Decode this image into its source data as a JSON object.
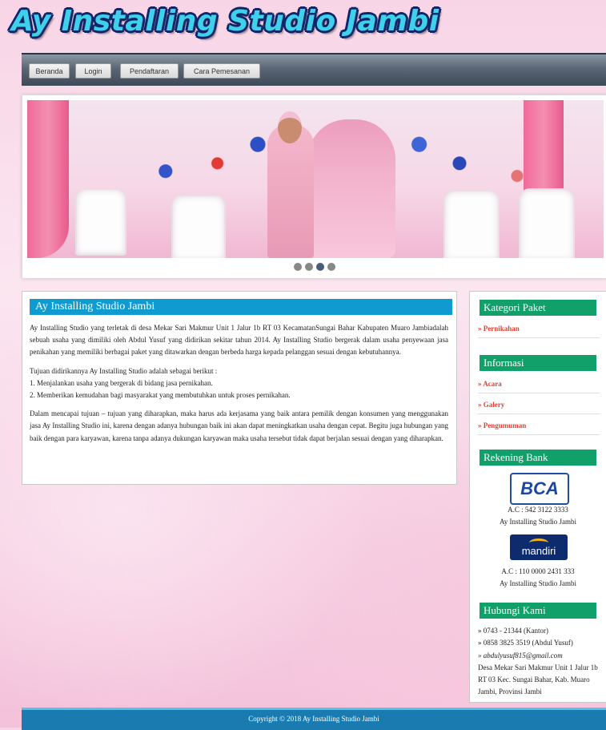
{
  "header": {
    "logo_text": "Ay Installing Studio Jambi"
  },
  "nav": {
    "items": [
      "Beranda",
      "Login",
      "Pendaftaran",
      "Cara Pemesanan"
    ]
  },
  "slider": {
    "dot_count": 4,
    "active_dot": 3
  },
  "main": {
    "title": "Ay Installing Studio Jambi",
    "paragraphs": [
      "Ay Installing Studio yang terletak di desa Mekar Sari Makmur Unit 1 Jalur 1b RT 03 KecamatanSungai Bahar Kabupaten Muaro Jambiadalah sebuah usaha yang dimiliki oleh Abdul Yusuf yang didirikan sekitar tahun 2014. Ay Installing Studio bergerak dalam usaha penyewaan jasa penikahan yang memiliki berbagai paket yang ditawarkan dengan berbeda harga kepada pelanggan sesuai dengan kebutuhannya.",
      "Tujuan didirikannya Ay Installing Studio adalah sebagai berikut :",
      "1. Menjalankan usaha yang bergerak di bidang jasa pernikahan.",
      "2. Memberikan kemudahan bagi masyarakat yang membutuhkan untuk proses pernikahan.",
      "Dalam mencapai tujuan – tujuan yang diharapkan, maka harus ada kerjasama yang baik antara pemilik dengan konsumen yang menggunakan jasa Ay Installing Studio ini, karena dengan adanya hubungan baik ini akan dapat meningkatkan usaha dengan cepat. Begitu juga hubungan yang baik dengan para karyawan, karena tanpa adanya dukungan karyawan maka usaha tersebut tidak dapat berjalan sesuai dengan yang diharapkan."
    ]
  },
  "sidebar": {
    "kategori_title": "Kategori Paket",
    "kategori_items": [
      "» Pernikahan"
    ],
    "informasi_title": "Informasi",
    "informasi_items": [
      "» Acara",
      "» Galery",
      "» Pengumuman"
    ],
    "rekening_title": "Rekening Bank",
    "bca": {
      "logo": "BCA",
      "account": "A.C : 542 3122 3333",
      "name": "Ay Installing Studio Jambi"
    },
    "mandiri": {
      "logo": "mandiri",
      "account": "A.C : 110 0000 2431 333",
      "name": "Ay Installing Studio Jambi"
    },
    "hubungi_title": "Hubungi Kami",
    "contacts": [
      "» 0743 - 21344 (Kantor)",
      "» 0858 3825 3519 (Abdul Yusuf)",
      "» abdulyusuf815@gmail.com",
      "Desa Mekar Sari Makmur Unit 1 Jalur 1b RT 03 Kec. Sungai Bahar, Kab. Muaro Jambi, Provinsi Jambi"
    ]
  },
  "footer": {
    "text": "Copyright © 2018 Ay Installing Studio Jambi"
  }
}
